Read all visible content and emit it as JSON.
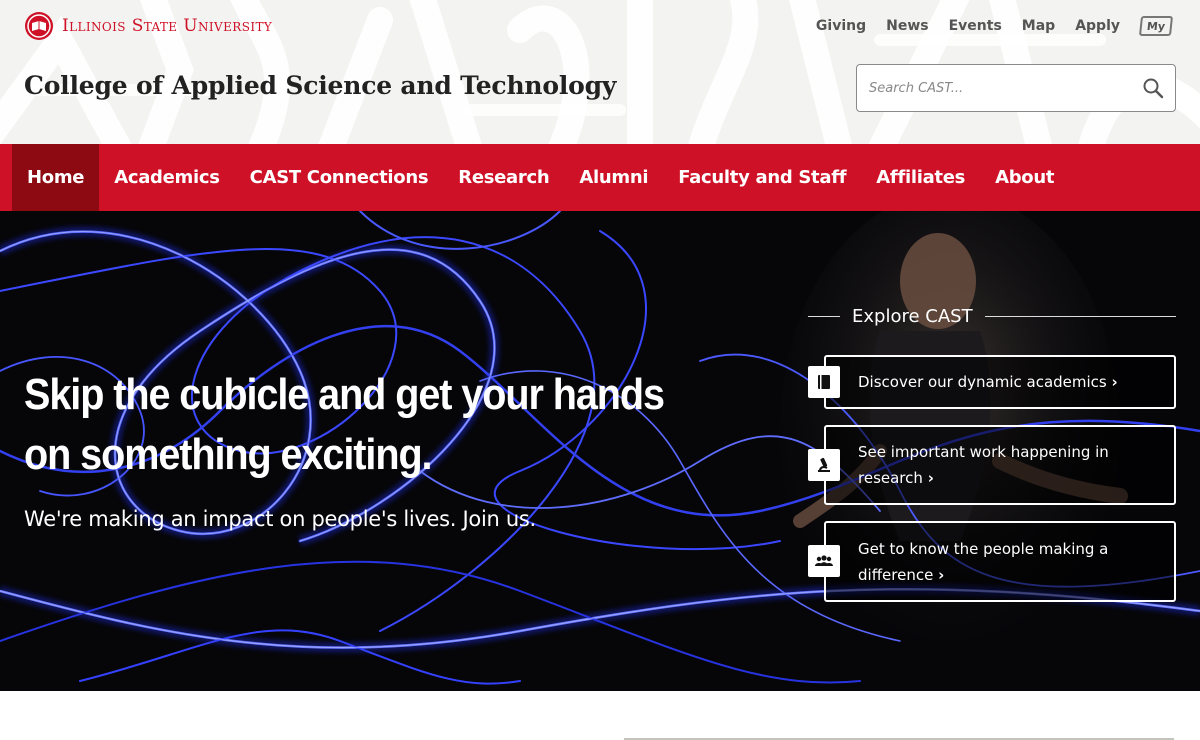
{
  "header": {
    "university_name": "Illinois State University",
    "college_title": "College of Applied Science and Technology",
    "utility_links": [
      "Giving",
      "News",
      "Events",
      "Map",
      "Apply"
    ],
    "my_badge": "My",
    "search": {
      "placeholder": "Search CAST...",
      "value": ""
    }
  },
  "nav": {
    "items": [
      {
        "label": "Home",
        "active": true
      },
      {
        "label": "Academics"
      },
      {
        "label": "CAST Connections"
      },
      {
        "label": "Research"
      },
      {
        "label": "Alumni"
      },
      {
        "label": "Faculty and Staff"
      },
      {
        "label": "Affiliates"
      },
      {
        "label": "About"
      }
    ]
  },
  "hero": {
    "headline": "Skip the cubicle and get your hands on something exciting.",
    "subheadline": "We're making an impact on people's lives. Join us.",
    "explore": {
      "title": "Explore CAST",
      "cards": [
        {
          "label": "Discover our dynamic academics",
          "icon": "book-icon"
        },
        {
          "label": "See important work happening in research",
          "icon": "microscope-icon"
        },
        {
          "label": "Get to know the people making a difference",
          "icon": "people-icon"
        }
      ]
    }
  },
  "colors": {
    "brand_red": "#ce1126",
    "nav_active": "#8e0a12",
    "hero_bg": "#060609",
    "light_trail": "#3a4cff"
  }
}
